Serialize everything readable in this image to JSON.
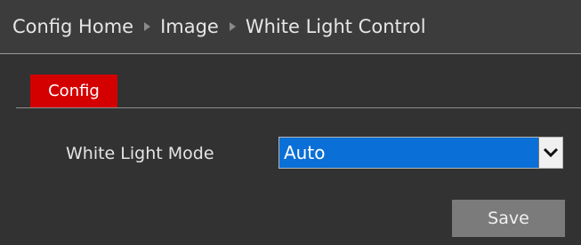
{
  "breadcrumb": {
    "items": [
      "Config Home",
      "Image",
      "White Light Control"
    ],
    "separator_icon": "triangle-right-icon"
  },
  "tabs": [
    {
      "label": "Config",
      "active": true,
      "color": "#d40000"
    }
  ],
  "form": {
    "white_light_mode": {
      "label": "White Light Mode",
      "value": "Auto",
      "dropdown_icon": "chevron-down-icon",
      "highlight_color": "#0a6fd6"
    }
  },
  "actions": {
    "save_label": "Save"
  }
}
